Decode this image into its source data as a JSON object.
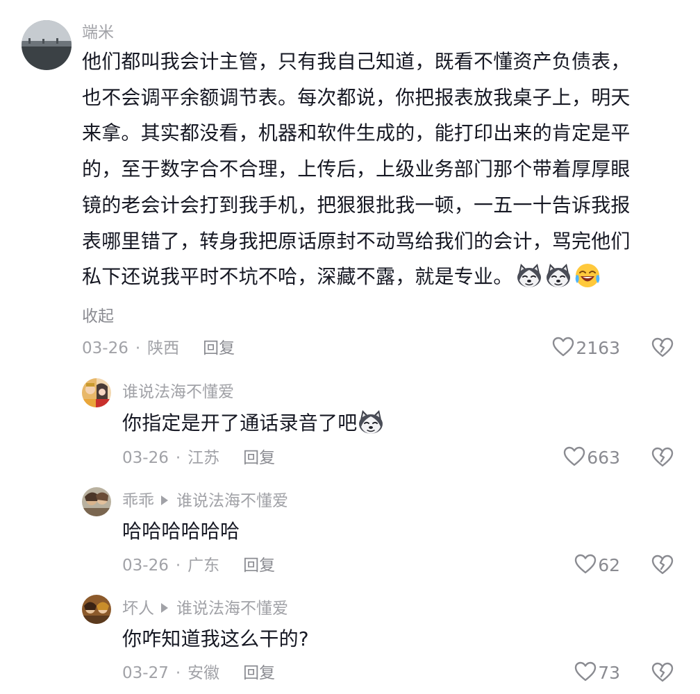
{
  "comments": [
    {
      "user": "端米",
      "lines": [
        "他们都叫我会计主管，只有我自己知道，既看不懂资产负债表，",
        "也不会调平余额调节表。每次都说，你把报表放我桌子上，明天",
        "来拿。其实都没看，机器和软件生成的，能打印出来的肯定是平",
        "的，至于数字合不合理，上传后，上级业务部门那个带着厚厚眼",
        "镜的老会计会打到我手机，把狠狠批我一顿，一五一十告诉我报",
        "表哪里错了，转身我把原话原封不动骂给我们的会计，骂完他们",
        "私下还说我平时不坑不哈，深藏不露，就是专业。"
      ],
      "emojis": [
        "husky-emoji",
        "husky-emoji",
        "laughing-crying-emoji"
      ],
      "collapse": "收起",
      "date": "03-26",
      "location": "陕西",
      "reply": "回复",
      "likes": "2163"
    },
    {
      "user": "谁说法海不懂爱",
      "text": "你指定是开了通话录音了吧",
      "emojis": [
        "husky-emoji"
      ],
      "date": "03-26",
      "location": "江苏",
      "reply": "回复",
      "likes": "663"
    },
    {
      "user": "乖乖",
      "reply_to": "谁说法海不懂爱",
      "text": "哈哈哈哈哈哈",
      "date": "03-26",
      "location": "广东",
      "reply": "回复",
      "likes": "62"
    },
    {
      "user": "坏人",
      "reply_to": "谁说法海不懂爱",
      "text": "你咋知道我这么干的?",
      "date": "03-27",
      "location": "安徽",
      "reply": "回复",
      "likes": "73"
    }
  ],
  "separator": "·",
  "icons": {
    "like": "heart-outline-icon",
    "dislike": "broken-heart-icon"
  },
  "colors": {
    "text": "#161823",
    "secondary": "#a1a2a7",
    "icon": "#8a8b91"
  }
}
